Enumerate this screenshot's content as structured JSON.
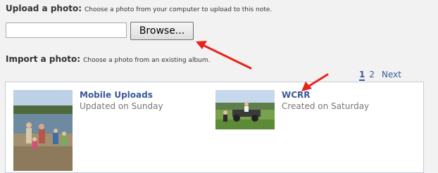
{
  "upload": {
    "label": "Upload a photo:",
    "hint": "Choose a photo from your computer to upload to this note.",
    "file_value": "",
    "browse_label": "Browse..."
  },
  "import": {
    "label": "Import a photo:",
    "hint": "Choose a photo from an existing album."
  },
  "pagination": {
    "current": "1",
    "page2": "2",
    "next": "Next"
  },
  "albums": [
    {
      "title": "Mobile Uploads",
      "subtitle": "Updated on Sunday",
      "thumb_icon": "beach-photo"
    },
    {
      "title": "WCRR",
      "subtitle": "Created on Saturday",
      "thumb_icon": "field-photo"
    }
  ],
  "colors": {
    "link": "#3b5998",
    "annotation_arrow": "#e8231b"
  }
}
